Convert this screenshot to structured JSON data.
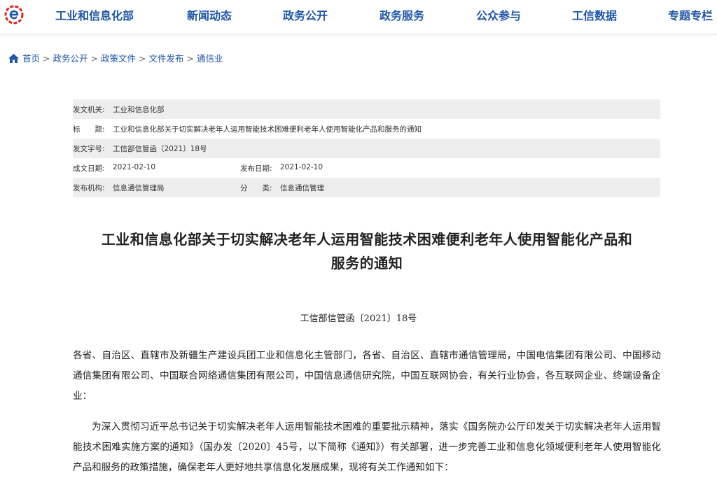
{
  "nav": {
    "items": [
      "工业和信息化部",
      "新闻动态",
      "政务公开",
      "政务服务",
      "公众参与",
      "工信数据",
      "专题专栏"
    ]
  },
  "breadcrumb": {
    "items": [
      "首页",
      "政务公开",
      "政策文件",
      "文件发布",
      "通信业"
    ],
    "separator": ">"
  },
  "meta": {
    "issuer_label": "发文机关:",
    "issuer": "工业和信息化部",
    "title_label": "标　　题:",
    "title": "工业和信息化部关于切实解决老年人运用智能技术困难便利老年人使用智能化产品和服务的通知",
    "docno_label": "发文字号:",
    "docno": "工信部信管函〔2021〕18号",
    "created_label": "成文日期:",
    "created": "2021-02-10",
    "published_label": "发布日期:",
    "published": "2021-02-10",
    "agency_label": "发布机构:",
    "agency": "信息通信管理局",
    "category_label": "分　　类:",
    "category": "信息通信管理"
  },
  "doc": {
    "title_line1": "工业和信息化部关于切实解决老年人运用智能技术困难便利老年人使用智能化产品和",
    "title_line2": "服务的通知",
    "number": "工信部信管函〔2021〕18号",
    "para1": "各省、自治区、直辖市及新疆生产建设兵团工业和信息化主管部门，各省、自治区、直辖市通信管理局，中国电信集团有限公司、中国移动通信集团有限公司、中国联合网络通信集团有限公司，中国信息通信研究院，中国互联网协会，有关行业协会，各互联网企业、终端设备企业：",
    "para2": "为深入贯彻习近平总书记关于切实解决老年人运用智能技术困难的重要批示精神，落实《国务院办公厅印发关于切实解决老年人运用智能技术困难实施方案的通知》（国办发〔2020〕45号，以下简称《通知》）有关部署，进一步完善工业和信息化领域便利老年人使用智能化产品和服务的政策措施，确保老年人更好地共享信息化发展成果，现将有关工作通知如下："
  },
  "colors": {
    "nav_text": "#1f56a8",
    "logo_red": "#d9251c",
    "logo_blue": "#1f56a8",
    "meta_shade": "#eeeeee"
  },
  "icons": {
    "logo": "mii-logo-icon",
    "home": "home-icon"
  }
}
